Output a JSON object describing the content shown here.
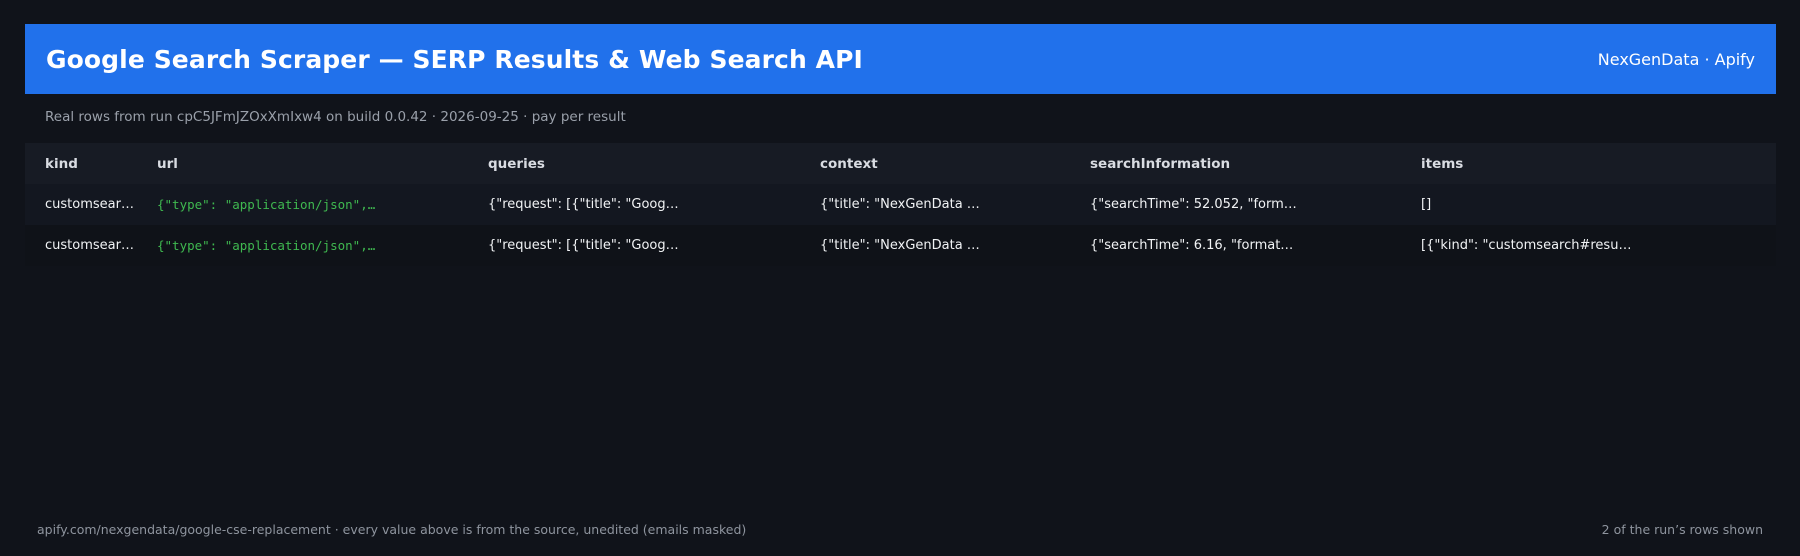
{
  "header": {
    "title": "Google Search Scraper — SERP Results & Web Search API",
    "brand": "NexGenData · Apify"
  },
  "subtitle": "Real rows from run cpC5JFmJZOxXmIxw4 on build 0.0.42 · 2026-09-25 · pay per result",
  "table": {
    "columns": [
      "kind",
      "url",
      "queries",
      "context",
      "searchInformation",
      "items"
    ],
    "rows": [
      {
        "kind": "customsear…",
        "url": "{\"type\": \"application/json\",…",
        "queries": "{\"request\": [{\"title\": \"Goog…",
        "context": "{\"title\": \"NexGenData …",
        "searchInformation": "{\"searchTime\": 52.052, \"form…",
        "items": "[]"
      },
      {
        "kind": "customsear…",
        "url": "{\"type\": \"application/json\",…",
        "queries": "{\"request\": [{\"title\": \"Goog…",
        "context": "{\"title\": \"NexGenData …",
        "searchInformation": "{\"searchTime\": 6.16, \"format…",
        "items": "[{\"kind\": \"customsearch#resu…"
      }
    ]
  },
  "footer": {
    "left": "apify.com/nexgendata/google-cse-replacement  ·  every value above is from the source, unedited (emails masked)",
    "right": "2 of the run’s rows shown"
  },
  "colors": {
    "background": "#10131a",
    "header": "#2171eb",
    "url_text": "#3fb950"
  }
}
